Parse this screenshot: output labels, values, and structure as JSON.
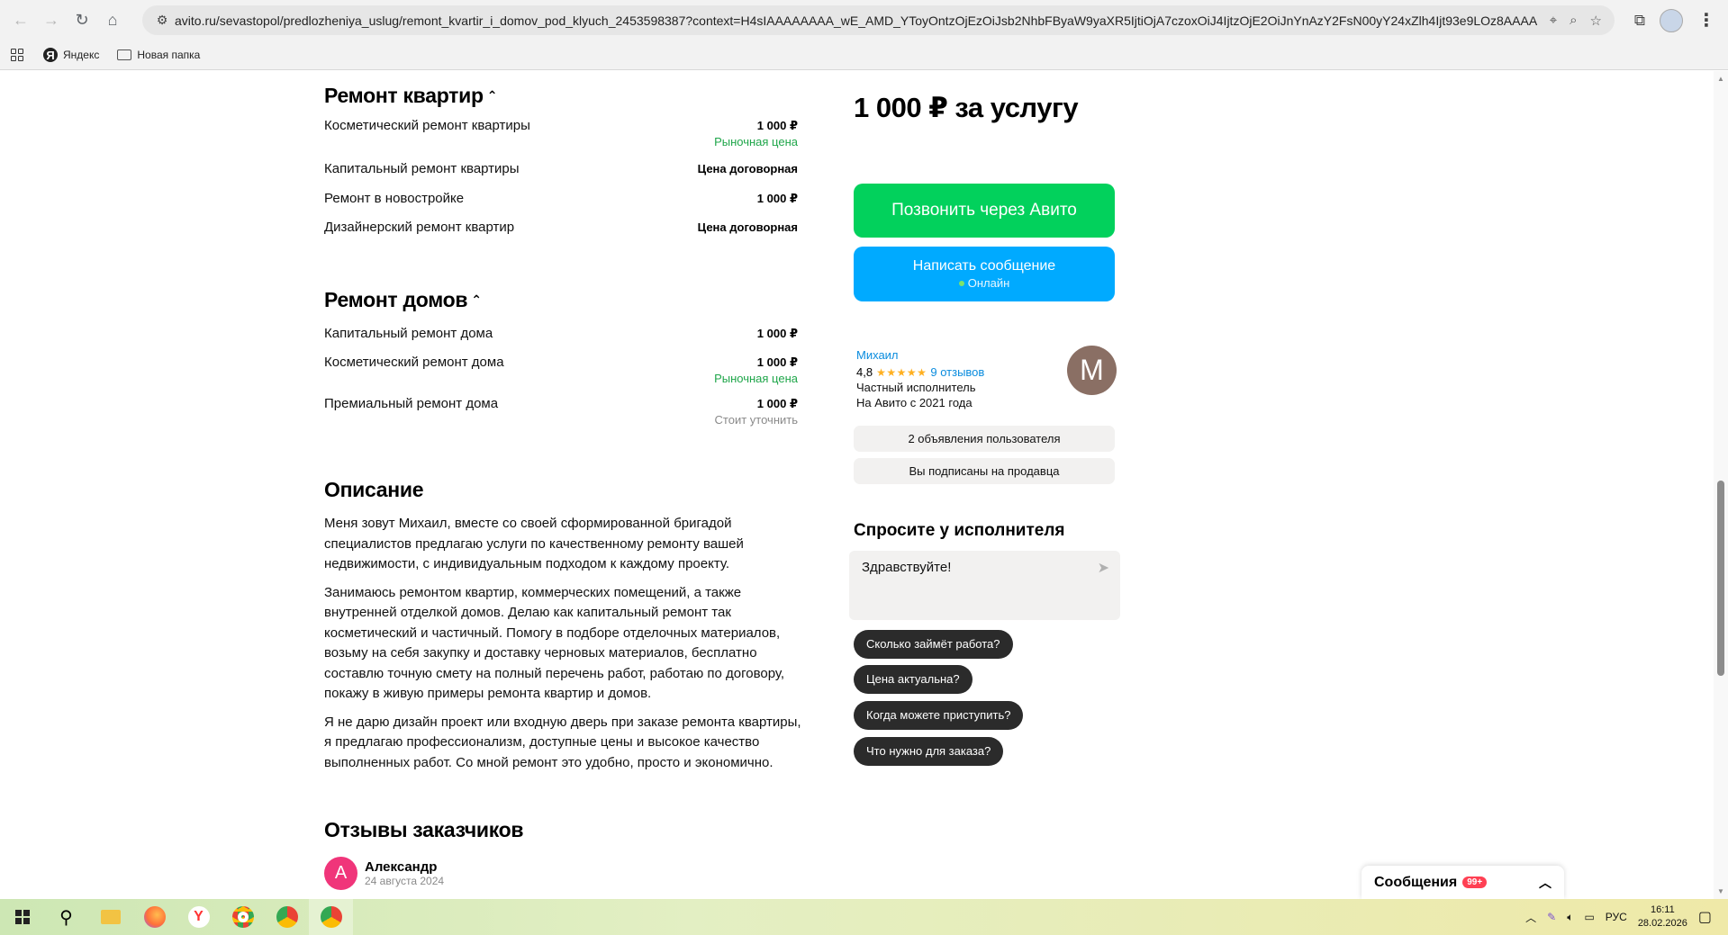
{
  "browser": {
    "url": "avito.ru/sevastopol/predlozheniya_uslug/remont_kvartir_i_domov_pod_klyuch_2453598387?context=H4sIAAAAAAAA_wE_AMD_YToyOntzOjEzOiJsb2NhbFByaW9yaXR5IjtiOjA7czoxOiJ4IjtzOjE2OiJnYnAzY2FsN00yY24xZlh4Ijt93e9LOz8AAAA",
    "bookmarks": [
      "Яндекс",
      "Новая папка"
    ]
  },
  "apartments": {
    "title": "Ремонт квартир",
    "items": [
      {
        "name": "Косметический ремонт квартиры",
        "price": "1 000 ₽",
        "note": "Рыночная цена",
        "note_color": "green"
      },
      {
        "name": "Капитальный ремонт квартиры",
        "price": "Цена договорная",
        "note": "",
        "note_color": ""
      },
      {
        "name": "Ремонт в новостройке",
        "price": "1 000 ₽",
        "note": "",
        "note_color": ""
      },
      {
        "name": "Дизайнерский ремонт квартир",
        "price": "Цена договорная",
        "note": "",
        "note_color": ""
      }
    ]
  },
  "houses": {
    "title": "Ремонт домов",
    "items": [
      {
        "name": "Капитальный ремонт дома",
        "price": "1 000 ₽",
        "note": "",
        "note_color": ""
      },
      {
        "name": "Косметический ремонт дома",
        "price": "1 000 ₽",
        "note": "Рыночная цена",
        "note_color": "green"
      },
      {
        "name": "Премиальный ремонт дома",
        "price": "1 000 ₽",
        "note": "Стоит уточнить",
        "note_color": "gray"
      }
    ]
  },
  "description": {
    "title": "Описание",
    "paragraphs": [
      "Меня зовут Михаил, вместе со своей сформированной бригадой специалистов предлагаю услуги по качественному ремонту вашей недвижимости, с индивидуальным подходом к каждому проекту.",
      "Занимаюсь ремонтом квартир, коммерческих помещений, а также внутренней отделкой домов. Делаю как капитальный ремонт так косметический и частичный. Помогу в подборе отделочных материалов, возьму на себя закупку и доставку черновых материалов, бесплатно составлю точную смету на полный перечень работ, работаю по договору, покажу в живую примеры ремонта квартир и домов.",
      "Я не дарю дизайн проект или входную дверь при заказе ремонта квартиры, я предлагаю профессионализм, доступные цены и высокое качество выполненных работ. Со мной ремонт это удобно, просто и экономично."
    ]
  },
  "reviews": {
    "title": "Отзывы заказчиков",
    "first": {
      "avatar_letter": "А",
      "name": "Александр",
      "date": "24 августа 2024"
    }
  },
  "sidebar": {
    "price": "1 000 ₽ за услугу",
    "call_button": "Позвонить через Авито",
    "message_button": "Написать сообщение",
    "online_label": "Онлайн",
    "seller": {
      "name": "Михаил",
      "rating": "4,8",
      "stars": "★★★★★",
      "reviews_link": "9 отзывов",
      "type": "Частный исполнитель",
      "since": "На Авито с 2021 года",
      "avatar_letter": "М"
    },
    "ads_button": "2 объявления пользователя",
    "subscribed_button": "Вы подписаны на продавца",
    "ask": {
      "title": "Спросите у исполнителя",
      "input_value": "Здравствуйте!",
      "chips": [
        "Сколько займёт работа?",
        "Цена актуальна?",
        "Когда можете приступить?",
        "Что нужно для заказа?"
      ]
    }
  },
  "messages_widget": {
    "label": "Сообщения",
    "badge": "99+"
  },
  "taskbar": {
    "lang": "РУС",
    "time": "16:11",
    "date": "28.02.2026"
  },
  "colors": {
    "call": "#02d15c",
    "message": "#00aaff",
    "green_note": "#1fa64a",
    "link": "#0a8cde",
    "star": "#ffb021"
  }
}
